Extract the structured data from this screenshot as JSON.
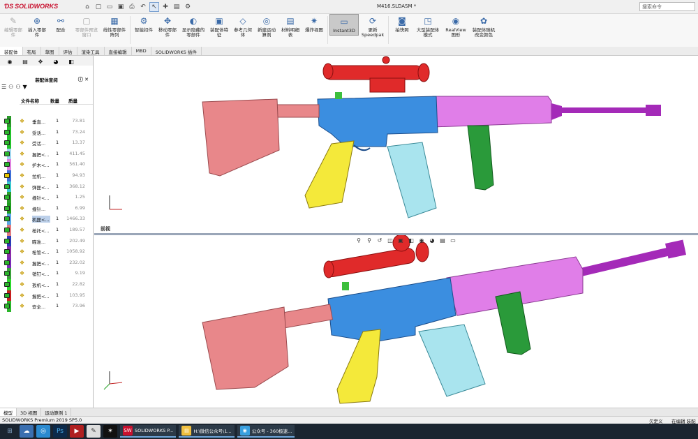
{
  "app": {
    "logo": "SOLIDWORKS",
    "document_title": "M416.SLDASM *",
    "search_placeholder": "搜索命令"
  },
  "ribbon": [
    {
      "label": "编辑零部件",
      "icon": "edit-component-icon",
      "disabled": true
    },
    {
      "label": "插入零部件",
      "icon": "insert-components-icon",
      "disabled": false
    },
    {
      "label": "配合",
      "icon": "mate-icon",
      "disabled": false
    },
    {
      "label": "零部件预览窗口",
      "icon": "component-preview-icon",
      "disabled": true
    },
    {
      "label": "线性零部件阵列",
      "icon": "linear-pattern-icon",
      "disabled": false
    },
    {
      "label": "智能扣件",
      "icon": "smart-fasteners-icon",
      "disabled": false
    },
    {
      "label": "移动零部件",
      "icon": "move-component-icon",
      "disabled": false
    },
    {
      "label": "显示隐藏的零部件",
      "icon": "show-hidden-icon",
      "disabled": false
    },
    {
      "label": "装配体特征",
      "icon": "assembly-features-icon",
      "disabled": false
    },
    {
      "label": "参考几何体",
      "icon": "reference-geometry-icon",
      "disabled": false
    },
    {
      "label": "新建运动算例",
      "icon": "new-motion-study-icon",
      "disabled": false
    },
    {
      "label": "材料明细表",
      "icon": "bom-icon",
      "disabled": false
    },
    {
      "label": "爆炸视图",
      "icon": "exploded-view-icon",
      "disabled": false
    },
    {
      "label": "Instant3D",
      "icon": "instant3d-icon",
      "disabled": false,
      "selected": true
    },
    {
      "label": "更新Speedpak",
      "icon": "speedpak-icon",
      "disabled": false
    },
    {
      "label": "拍快照",
      "icon": "snapshot-icon",
      "disabled": false
    },
    {
      "label": "大型装配体模式",
      "icon": "large-assembly-icon",
      "disabled": false
    },
    {
      "label": "RealView图形",
      "icon": "realview-icon",
      "disabled": false
    },
    {
      "label": "装配体随机改变颜色",
      "icon": "random-color-icon",
      "disabled": false
    }
  ],
  "command_tabs": [
    {
      "label": "装配体",
      "active": true
    },
    {
      "label": "布局"
    },
    {
      "label": "草图"
    },
    {
      "label": "评估"
    },
    {
      "label": "渲染工具"
    },
    {
      "label": "直接编辑"
    },
    {
      "label": "MBD"
    },
    {
      "label": "SOLIDWORKS 插件"
    }
  ],
  "panel": {
    "title": "装配体查阅",
    "columns": [
      "文件名称",
      "数量",
      "质量"
    ],
    "rows": [
      {
        "name": "垂直...",
        "qty": "1",
        "mass": "73.81",
        "color": "#2a9a2a",
        "flag": "#2ab52a"
      },
      {
        "name": "受话...",
        "qty": "1",
        "mass": "73.24",
        "color": "#22c22a",
        "flag": "#2ab52a"
      },
      {
        "name": "受话...",
        "qty": "1",
        "mass": "13.37",
        "color": "#22c22a",
        "flag": "#2ab52a"
      },
      {
        "name": "握把<...",
        "qty": "1",
        "mass": "411.45",
        "color": "#9fd7f0",
        "flag": "#2ab52a"
      },
      {
        "name": "护木<...",
        "qty": "1",
        "mass": "561.40",
        "color": "#e080e0",
        "flag": "#2ab52a"
      },
      {
        "name": "拉机...",
        "qty": "1",
        "mass": "94.93",
        "color": "#3c6fd8",
        "flag": "#e6c800"
      },
      {
        "name": "弹匣<...",
        "qty": "1",
        "mass": "368.12",
        "color": "#39c9cf",
        "flag": "#2ab52a"
      },
      {
        "name": "撞针<...",
        "qty": "1",
        "mass": "1.25",
        "color": "#2aa02a",
        "flag": "#2ab52a"
      },
      {
        "name": "撞针...",
        "qty": "1",
        "mass": "6.99",
        "color": "#1e9d1e",
        "flag": "#2ab52a"
      },
      {
        "name": "机匣<...",
        "qty": "1",
        "mass": "1466.33",
        "color": "#5da8e6",
        "flag": "#2ab52a",
        "selected": true
      },
      {
        "name": "枪托<...",
        "qty": "1",
        "mass": "189.57",
        "color": "#e07a80",
        "flag": "#2ab52a"
      },
      {
        "name": "瞄准...",
        "qty": "1",
        "mass": "202.49",
        "color": "#2a3cb8",
        "flag": "#2ab52a"
      },
      {
        "name": "枪管<...",
        "qty": "1",
        "mass": "1058.92",
        "color": "#8a2aa8",
        "flag": "#2ab52a"
      },
      {
        "name": "握把<...",
        "qty": "1",
        "mass": "232.02",
        "color": "#7a2ab8",
        "flag": "#2ab52a"
      },
      {
        "name": "销钉<...",
        "qty": "1",
        "mass": "9.19",
        "color": "#3aa03a",
        "flag": "#2ab52a"
      },
      {
        "name": "扳机<...",
        "qty": "1",
        "mass": "22.82",
        "color": "#2ad82a",
        "flag": "#2ab52a"
      },
      {
        "name": "握把<...",
        "qty": "1",
        "mass": "103.95",
        "color": "#c81e1e",
        "flag": "#2ab52a"
      },
      {
        "name": "安全...",
        "qty": "1",
        "mass": "73.96",
        "color": "#2ab52a",
        "flag": "#2ab52a"
      }
    ]
  },
  "viewport": {
    "top_label": "前视"
  },
  "bottom_tabs": [
    {
      "label": "模型",
      "active": true
    },
    {
      "label": "3D 视图"
    },
    {
      "label": "运动算例 1"
    }
  ],
  "status": {
    "left": "SOLIDWORKS Premium 2019 SP5.0",
    "right1": "欠定义",
    "right2": "在编辑 装配体"
  },
  "taskbar": [
    {
      "label": "SOLIDWORKS P...",
      "color": "#c8102e",
      "icon": "solidworks-app-icon",
      "glyph": "SW"
    },
    {
      "label": "H:\\微信公众号\\1...",
      "color": "#f0c040",
      "icon": "folder-app-icon",
      "glyph": "▤"
    },
    {
      "label": "公众号 - 360极速...",
      "color": "#3aa0e0",
      "icon": "browser-app-icon",
      "glyph": "◉"
    }
  ],
  "colors": {
    "stock": "#e8878a",
    "receiver": "#3b8ee0",
    "magazine": "#a9e4ee",
    "grip": "#f4e93a",
    "handguard": "#e07ee8",
    "barrel": "#a42ab8",
    "scope": "#e02a2a",
    "vgrip": "#2a9a3a"
  }
}
